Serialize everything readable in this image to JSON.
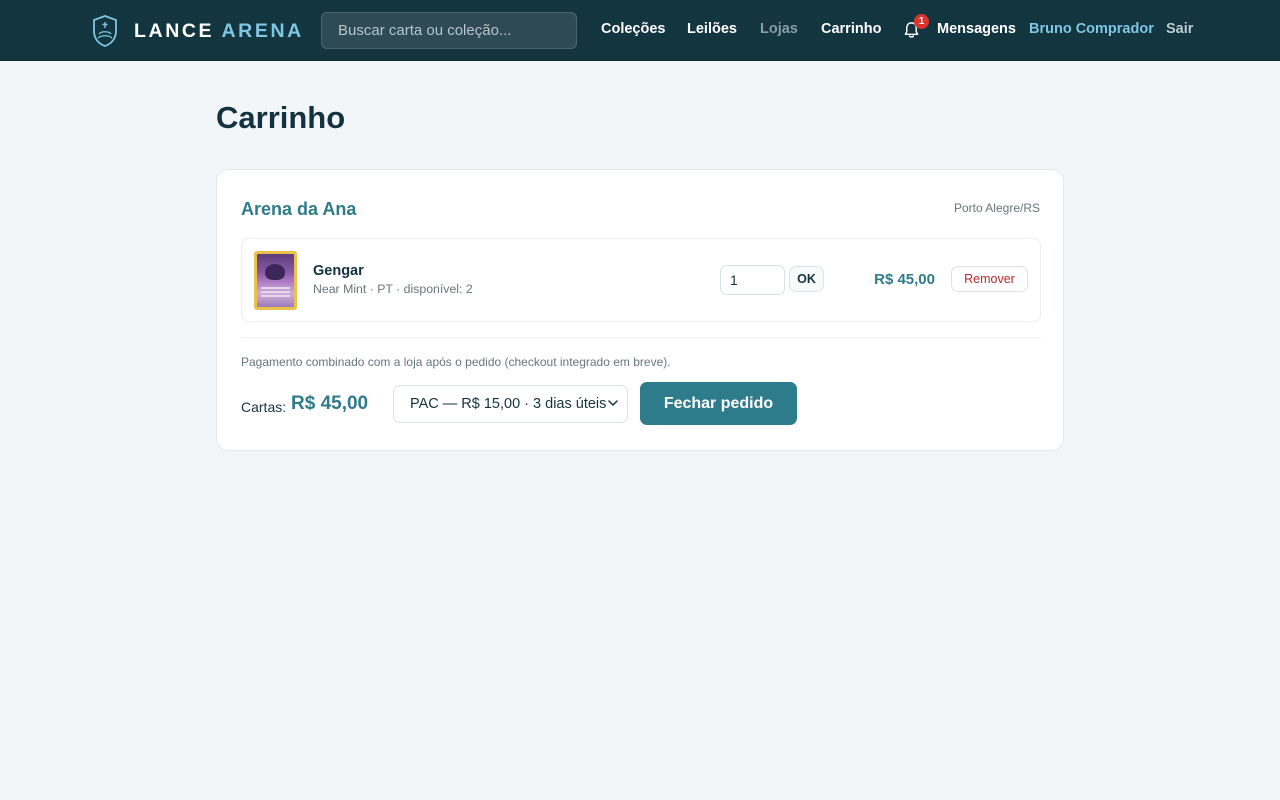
{
  "brand": {
    "part1": "LANCE",
    "part2": "ARENA"
  },
  "search": {
    "placeholder": "Buscar carta ou coleção..."
  },
  "nav": {
    "colecoes": "Coleções",
    "leiloes": "Leilões",
    "lojas": "Lojas",
    "carrinho": "Carrinho",
    "notifications_count": "1",
    "mensagens": "Mensagens",
    "user": "Bruno Comprador",
    "sair": "Sair"
  },
  "page": {
    "title": "Carrinho"
  },
  "cart": {
    "store": {
      "name": "Arena da Ana",
      "location": "Porto Alegre/RS"
    },
    "items": [
      {
        "name": "Gengar",
        "meta": "Near Mint · PT · disponível: 2",
        "quantity": "1",
        "ok_label": "OK",
        "price": "R$ 45,00",
        "remove_label": "Remover"
      }
    ],
    "note": "Pagamento combinado com a loja após o pedido (checkout integrado em breve).",
    "total_label": "Cartas:",
    "total_value": "R$ 45,00",
    "shipping_selected": "PAC — R$ 15,00 · 3 dias úteis",
    "checkout_label": "Fechar pedido"
  },
  "colors": {
    "header_bg": "#133540",
    "accent": "#2e7b8c",
    "accent_light": "#7fc6e3",
    "danger": "#b32e2a",
    "badge": "#d8342c",
    "page_bg": "#f3f6f8"
  },
  "icons": {
    "logo": "shield-icon",
    "notifications": "bell-icon",
    "select": "chevron-down-icon"
  }
}
